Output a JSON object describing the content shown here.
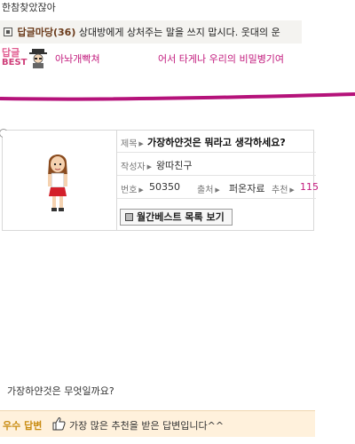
{
  "top": {
    "text": "한참찾았잖아"
  },
  "reply": {
    "title": "답글마당(36)",
    "text": "상대방에게 상처주는 말을 쓰지 맙시다. 웃대의 운"
  },
  "best": {
    "badge_line1": "답글",
    "badge_line2": "BEST",
    "user": "아놔개빡쳐",
    "title": "어서 타게나 우리의 비밀병기여"
  },
  "post": {
    "title_label": "제목",
    "title": "가장하얀것은 뭐라고 생각하세요?",
    "author_label": "작성자",
    "author": "왕따친구",
    "number_label": "번호",
    "number": "50350",
    "source_label": "출처",
    "source": "퍼온자료",
    "recommend_label": "추천",
    "recommend": "115",
    "best_list_button": "월간베스트 목록 보기"
  },
  "body": {
    "question": "가장하얀것은 무엇일까요?"
  },
  "answer": {
    "label": "우수 답변",
    "text": "가장 많은 추천을 받은 답변입니다^^"
  },
  "colors": {
    "accent_pink": "#c2197c",
    "rule_pink": "#b5127a",
    "answer_bg": "#fff1dc",
    "answer_label": "#c98c12"
  },
  "icons": [
    "checkbox-icon",
    "mascot-icon",
    "avatar-icon",
    "list-icon",
    "thumbs-up-icon"
  ]
}
